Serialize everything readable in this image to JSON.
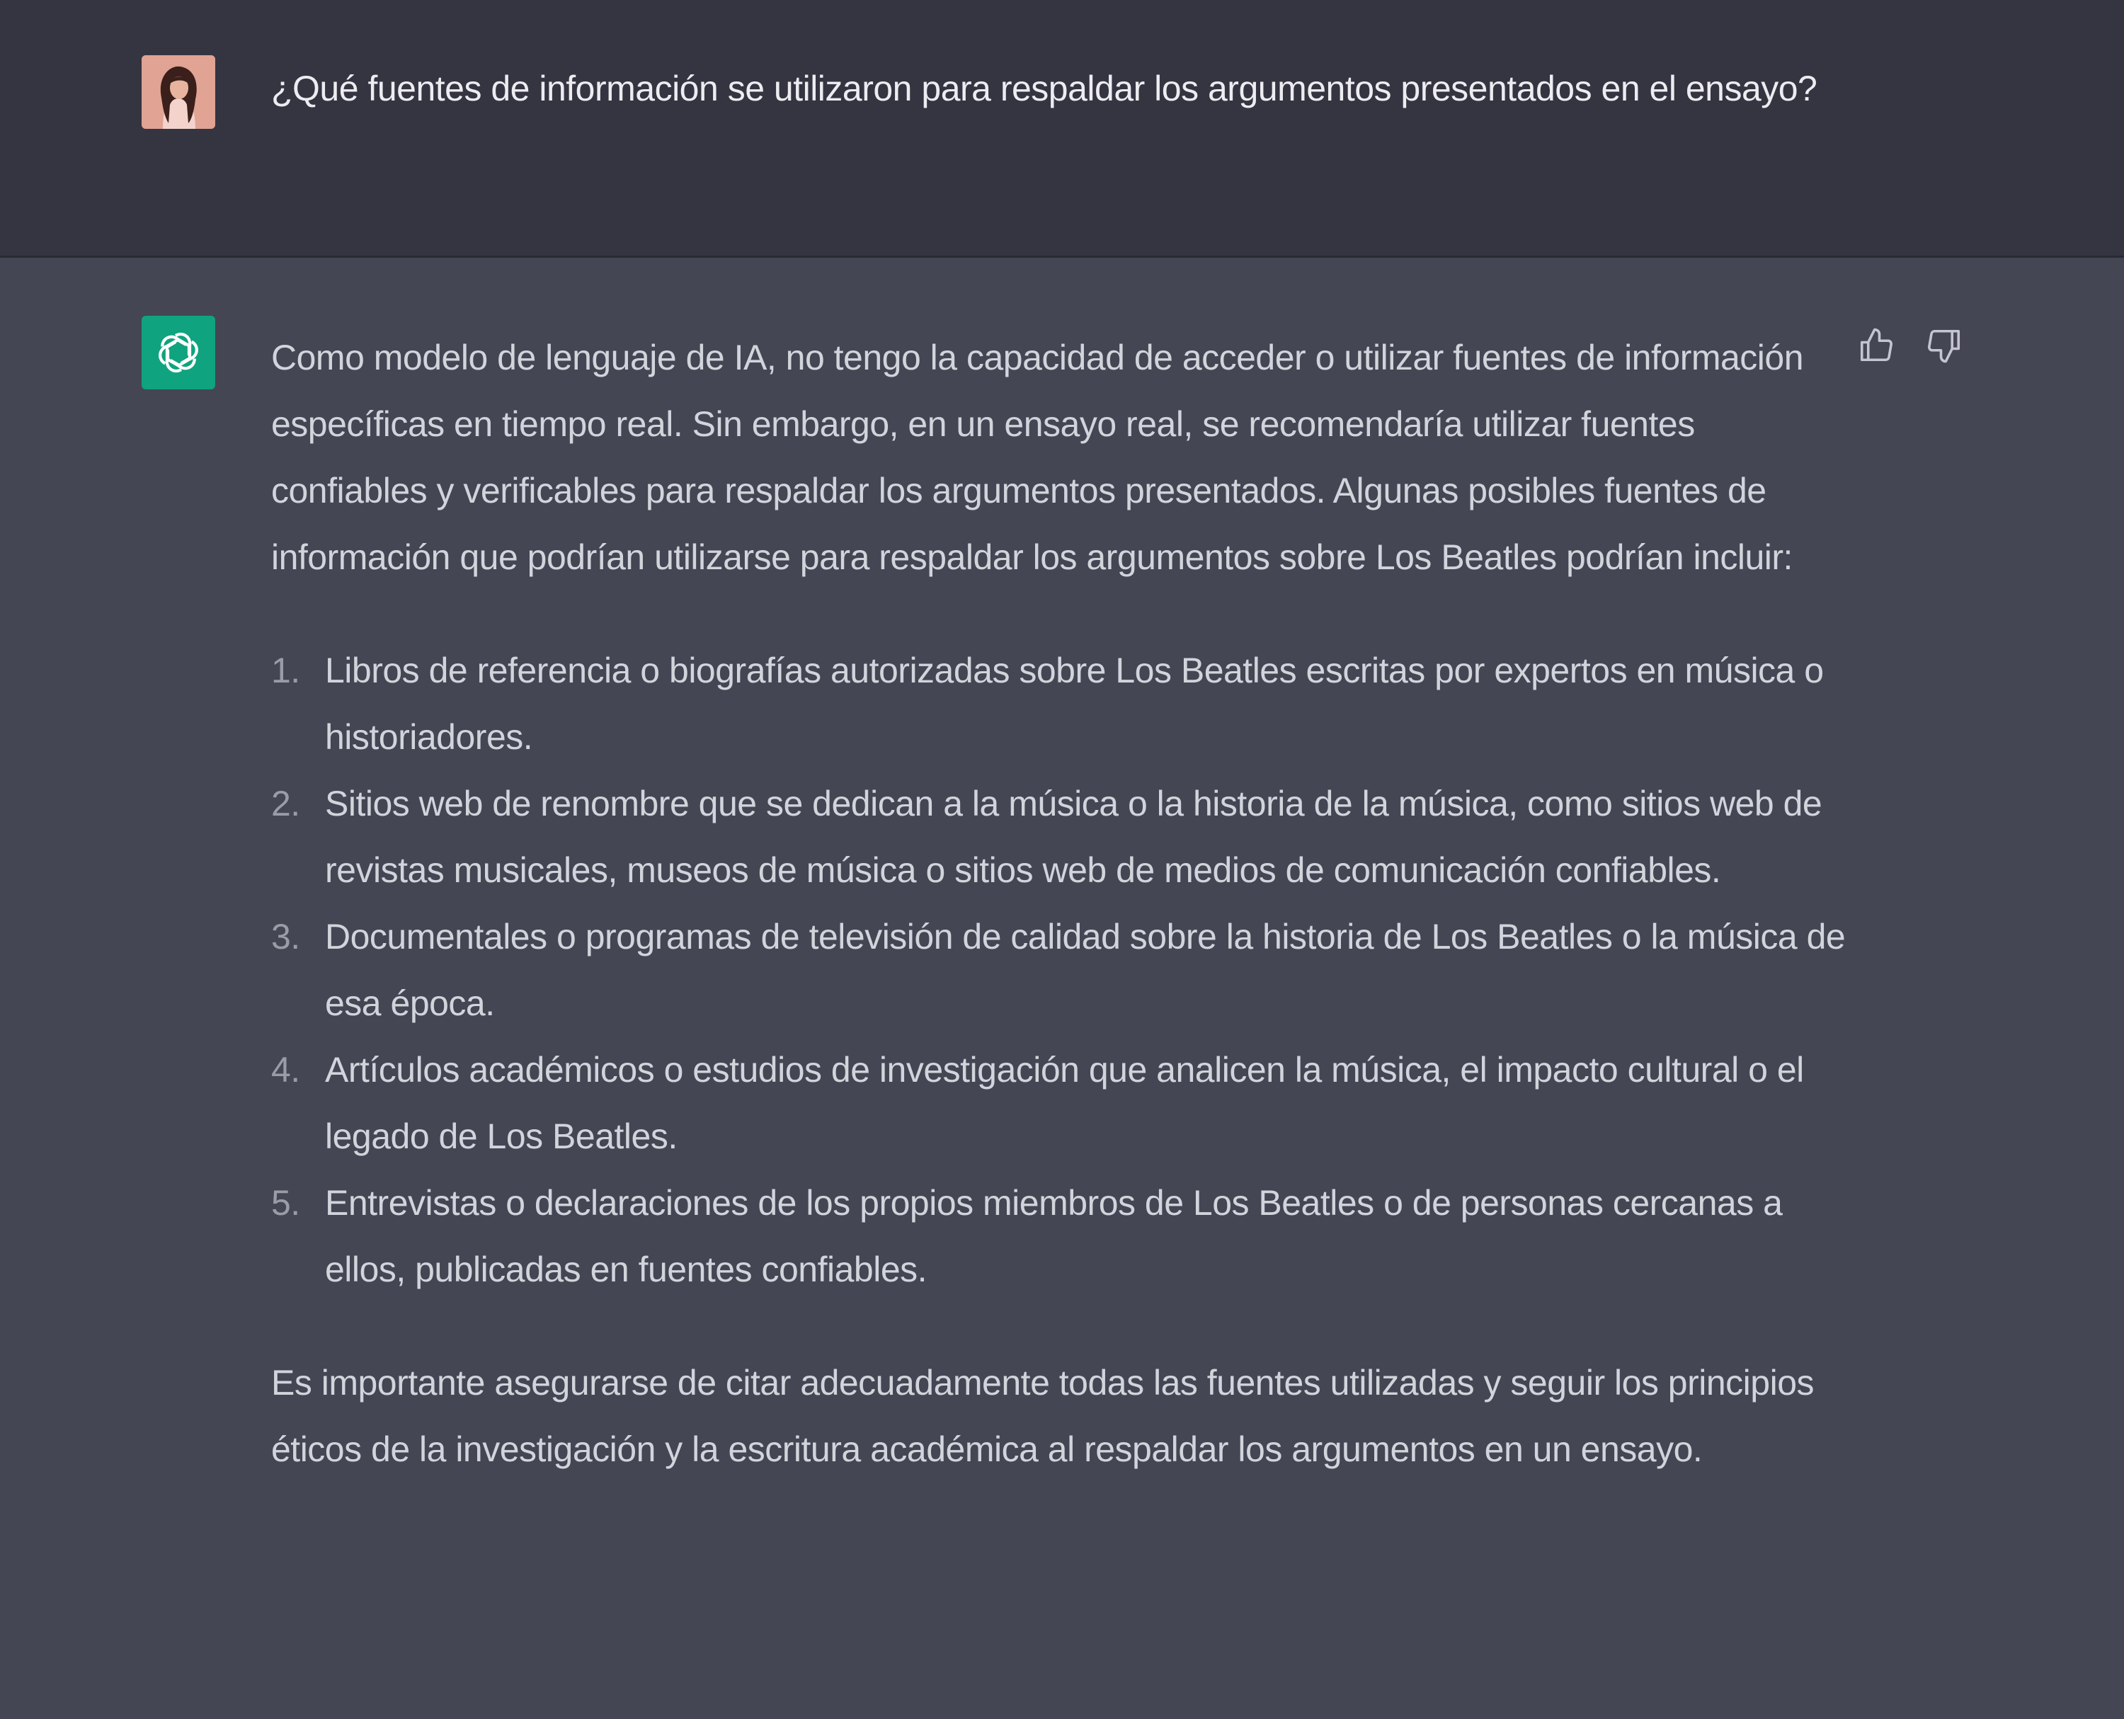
{
  "user_message": {
    "text": "¿Qué fuentes de información se utilizaron para respaldar los argumentos presentados en el ensayo?"
  },
  "assistant_message": {
    "intro": "Como modelo de lenguaje de IA, no tengo la capacidad de acceder o utilizar fuentes de información específicas en tiempo real. Sin embargo, en un ensayo real, se recomendaría utilizar fuentes confiables y verificables para respaldar los argumentos presentados. Algunas posibles fuentes de información que podrían utilizarse para respaldar los argumentos sobre Los Beatles podrían incluir:",
    "items": [
      {
        "num": "1.",
        "text": "Libros de referencia o biografías autorizadas sobre Los Beatles escritas por expertos en música o historiadores."
      },
      {
        "num": "2.",
        "text": "Sitios web de renombre que se dedican a la música o la historia de la música, como sitios web de revistas musicales, museos de música o sitios web de medios de comunicación confiables."
      },
      {
        "num": "3.",
        "text": "Documentales o programas de televisión de calidad sobre la historia de Los Beatles o la música de esa época."
      },
      {
        "num": "4.",
        "text": "Artículos académicos o estudios de investigación que analicen la música, el impacto cultural o el legado de Los Beatles."
      },
      {
        "num": "5.",
        "text": "Entrevistas o declaraciones de los propios miembros de Los Beatles o de personas cercanas a ellos, publicadas en fuentes confiables."
      }
    ],
    "conclusion": "Es importante asegurarse de citar adecuadamente todas las fuentes utilizadas y seguir los principios éticos de la investigación y la escritura académica al respaldar los argumentos en un ensayo."
  },
  "icons": {
    "user_avatar": "user-avatar-photo",
    "assistant_avatar": "openai-logo-icon",
    "like": "thumbs-up-icon",
    "dislike": "thumbs-down-icon"
  },
  "colors": {
    "user_bg": "#343541",
    "assistant_bg": "#444654",
    "assistant_avatar_bg": "#10a37f",
    "text": "#d1d5db"
  }
}
